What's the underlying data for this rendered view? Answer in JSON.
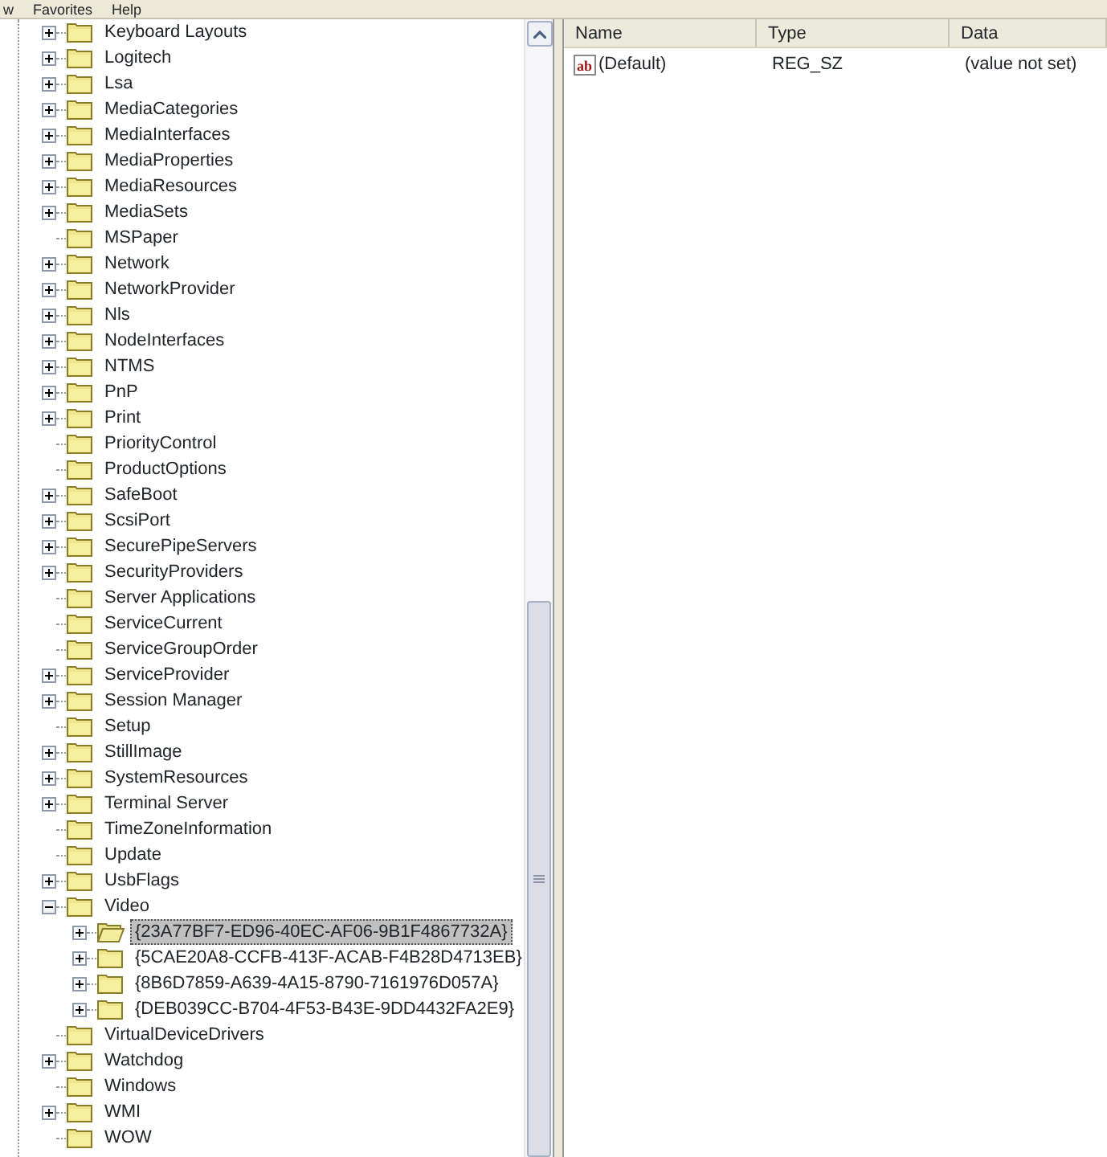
{
  "menu": [
    "w",
    "Favorites",
    "Help"
  ],
  "tree": [
    {
      "label": "Keyboard Layouts",
      "expandable": true,
      "expanded": false,
      "selected": false
    },
    {
      "label": "Logitech",
      "expandable": true,
      "expanded": false,
      "selected": false
    },
    {
      "label": "Lsa",
      "expandable": true,
      "expanded": false,
      "selected": false
    },
    {
      "label": "MediaCategories",
      "expandable": true,
      "expanded": false,
      "selected": false
    },
    {
      "label": "MediaInterfaces",
      "expandable": true,
      "expanded": false,
      "selected": false
    },
    {
      "label": "MediaProperties",
      "expandable": true,
      "expanded": false,
      "selected": false
    },
    {
      "label": "MediaResources",
      "expandable": true,
      "expanded": false,
      "selected": false
    },
    {
      "label": "MediaSets",
      "expandable": true,
      "expanded": false,
      "selected": false
    },
    {
      "label": "MSPaper",
      "expandable": false,
      "selected": false
    },
    {
      "label": "Network",
      "expandable": true,
      "expanded": false,
      "selected": false
    },
    {
      "label": "NetworkProvider",
      "expandable": true,
      "expanded": false,
      "selected": false
    },
    {
      "label": "Nls",
      "expandable": true,
      "expanded": false,
      "selected": false
    },
    {
      "label": "NodeInterfaces",
      "expandable": true,
      "expanded": false,
      "selected": false
    },
    {
      "label": "NTMS",
      "expandable": true,
      "expanded": false,
      "selected": false
    },
    {
      "label": "PnP",
      "expandable": true,
      "expanded": false,
      "selected": false
    },
    {
      "label": "Print",
      "expandable": true,
      "expanded": false,
      "selected": false
    },
    {
      "label": "PriorityControl",
      "expandable": false,
      "selected": false
    },
    {
      "label": "ProductOptions",
      "expandable": false,
      "selected": false
    },
    {
      "label": "SafeBoot",
      "expandable": true,
      "expanded": false,
      "selected": false
    },
    {
      "label": "ScsiPort",
      "expandable": true,
      "expanded": false,
      "selected": false
    },
    {
      "label": "SecurePipeServers",
      "expandable": true,
      "expanded": false,
      "selected": false
    },
    {
      "label": "SecurityProviders",
      "expandable": true,
      "expanded": false,
      "selected": false
    },
    {
      "label": "Server Applications",
      "expandable": false,
      "selected": false
    },
    {
      "label": "ServiceCurrent",
      "expandable": false,
      "selected": false
    },
    {
      "label": "ServiceGroupOrder",
      "expandable": false,
      "selected": false
    },
    {
      "label": "ServiceProvider",
      "expandable": true,
      "expanded": false,
      "selected": false
    },
    {
      "label": "Session Manager",
      "expandable": true,
      "expanded": false,
      "selected": false
    },
    {
      "label": "Setup",
      "expandable": false,
      "selected": false
    },
    {
      "label": "StillImage",
      "expandable": true,
      "expanded": false,
      "selected": false
    },
    {
      "label": "SystemResources",
      "expandable": true,
      "expanded": false,
      "selected": false
    },
    {
      "label": "Terminal Server",
      "expandable": true,
      "expanded": false,
      "selected": false
    },
    {
      "label": "TimeZoneInformation",
      "expandable": false,
      "selected": false
    },
    {
      "label": "Update",
      "expandable": false,
      "selected": false
    },
    {
      "label": "UsbFlags",
      "expandable": true,
      "expanded": false,
      "selected": false
    },
    {
      "label": "Video",
      "expandable": true,
      "expanded": true,
      "selected": false,
      "children": [
        {
          "label": "{23A77BF7-ED96-40EC-AF06-9B1F4867732A}",
          "expandable": true,
          "expanded": false,
          "selected": true
        },
        {
          "label": "{5CAE20A8-CCFB-413F-ACAB-F4B28D4713EB}",
          "expandable": true,
          "expanded": false,
          "selected": false
        },
        {
          "label": "{8B6D7859-A639-4A15-8790-7161976D057A}",
          "expandable": true,
          "expanded": false,
          "selected": false
        },
        {
          "label": "{DEB039CC-B704-4F53-B43E-9DD4432FA2E9}",
          "expandable": true,
          "expanded": false,
          "selected": false
        }
      ]
    },
    {
      "label": "VirtualDeviceDrivers",
      "expandable": false,
      "selected": false
    },
    {
      "label": "Watchdog",
      "expandable": true,
      "expanded": false,
      "selected": false
    },
    {
      "label": "Windows",
      "expandable": false,
      "selected": false
    },
    {
      "label": "WMI",
      "expandable": true,
      "expanded": false,
      "selected": false
    },
    {
      "label": "WOW",
      "expandable": false,
      "selected": false
    }
  ],
  "values": {
    "columns": [
      "Name",
      "Type",
      "Data"
    ],
    "rows": [
      {
        "icon": "ab",
        "name": "(Default)",
        "type": "REG_SZ",
        "data": "(value not set)"
      }
    ]
  }
}
